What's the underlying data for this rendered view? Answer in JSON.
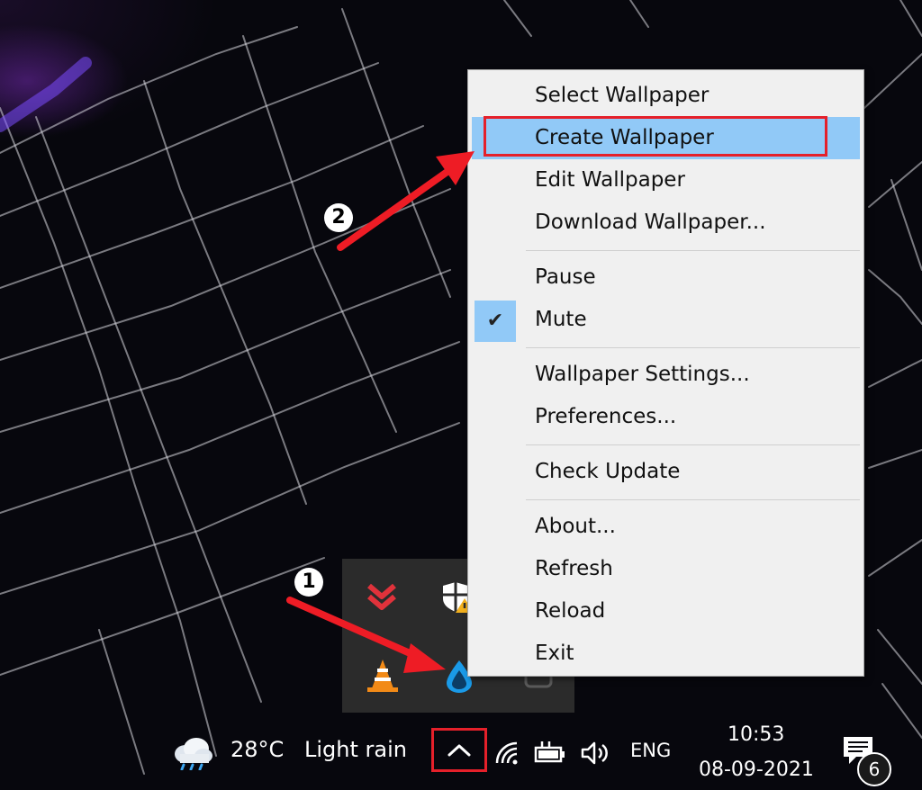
{
  "context_menu": {
    "items": [
      {
        "label": "Select Wallpaper"
      },
      {
        "label": "Create Wallpaper"
      },
      {
        "label": "Edit Wallpaper"
      },
      {
        "label": "Download Wallpaper..."
      },
      {
        "label": "Pause"
      },
      {
        "label": "Mute"
      },
      {
        "label": "Wallpaper Settings..."
      },
      {
        "label": "Preferences..."
      },
      {
        "label": "Check Update"
      },
      {
        "label": "About..."
      },
      {
        "label": "Refresh"
      },
      {
        "label": "Reload"
      },
      {
        "label": "Exit"
      }
    ],
    "highlighted_item": "Create Wallpaper",
    "checked_item": "Mute"
  },
  "tray_flyout": {
    "icons": [
      "download-manager-icon",
      "windows-security-warning-icon",
      "vlc-icon",
      "lively-wallpaper-drop-icon",
      "generic-app-icon"
    ]
  },
  "taskbar": {
    "weather_icon": "cloud-rain-icon",
    "temperature": "28°C",
    "weather_text": "Light rain",
    "chevron_icon": "chevron-up-icon",
    "tray_icons": [
      "wifi-icon",
      "battery-icon",
      "speaker-icon"
    ],
    "language": "ENG",
    "time": "10:53",
    "date": "08-09-2021",
    "notification_count": "6"
  },
  "annotations": {
    "step1": "1",
    "step2": "2"
  },
  "colors": {
    "menu_background": "#f0f0f0",
    "menu_highlight": "#91c9f7",
    "annotation_red": "#e5202a",
    "tray_flyout_background": "#2b2b2b"
  }
}
